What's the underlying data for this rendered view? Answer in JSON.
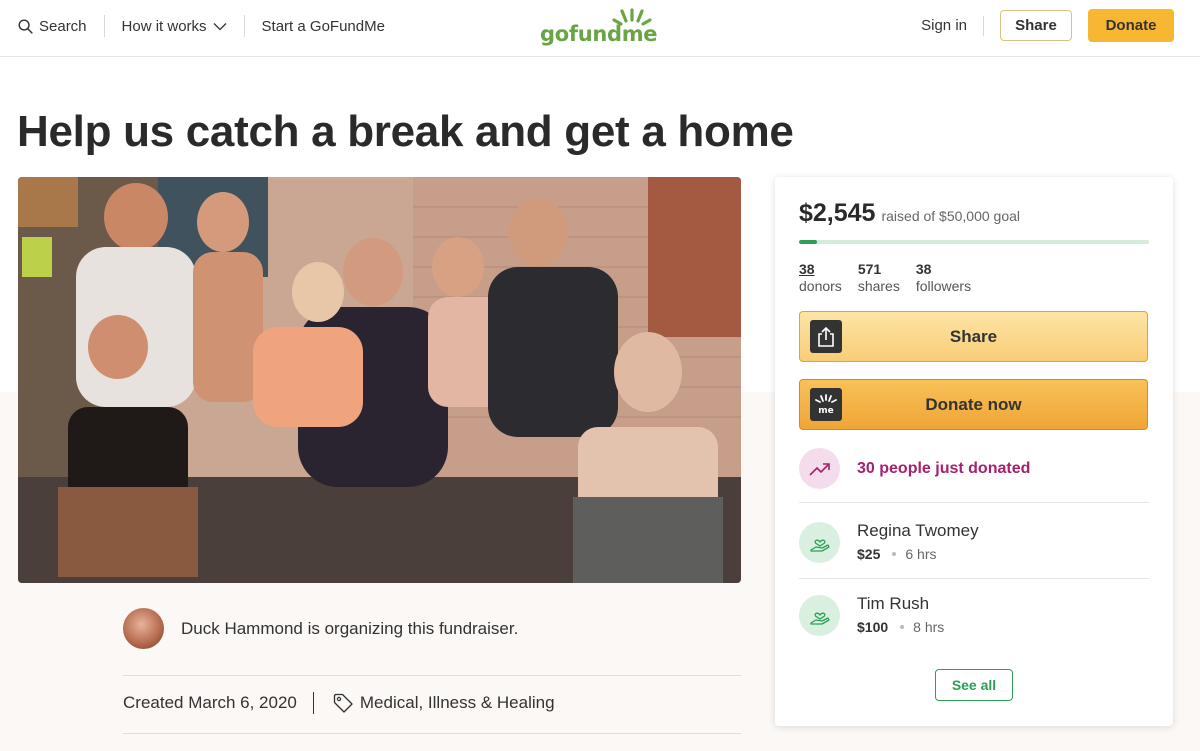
{
  "header": {
    "search_label": "Search",
    "how_it_works_label": "How it works",
    "start_label": "Start a GoFundMe",
    "logo_text": "gofundme",
    "signin_label": "Sign in",
    "share_label": "Share",
    "donate_label": "Donate"
  },
  "campaign": {
    "title": "Help us catch a break and get a home",
    "organizer_text": "Duck Hammond is organizing this fundraiser.",
    "created": "Created March 6, 2020",
    "category": "Medical, Illness & Healing"
  },
  "progress": {
    "raised": "$2,545",
    "goal_text": "raised of $50,000 goal",
    "fraction": 0.0509,
    "stats": [
      {
        "value": "38",
        "label": "donors"
      },
      {
        "value": "571",
        "label": "shares"
      },
      {
        "value": "38",
        "label": "followers"
      }
    ]
  },
  "actions": {
    "share_label": "Share",
    "donate_now_label": "Donate now",
    "trend_text": "30 people just donated",
    "see_all_label": "See all"
  },
  "donations": [
    {
      "name": "Regina Twomey",
      "amount": "$25",
      "time": "6 hrs"
    },
    {
      "name": "Tim Rush",
      "amount": "$100",
      "time": "8 hrs"
    }
  ],
  "colors": {
    "brand_green": "#2c9f54",
    "donate_orange": "#f7b733",
    "trend_magenta": "#a6206d"
  }
}
